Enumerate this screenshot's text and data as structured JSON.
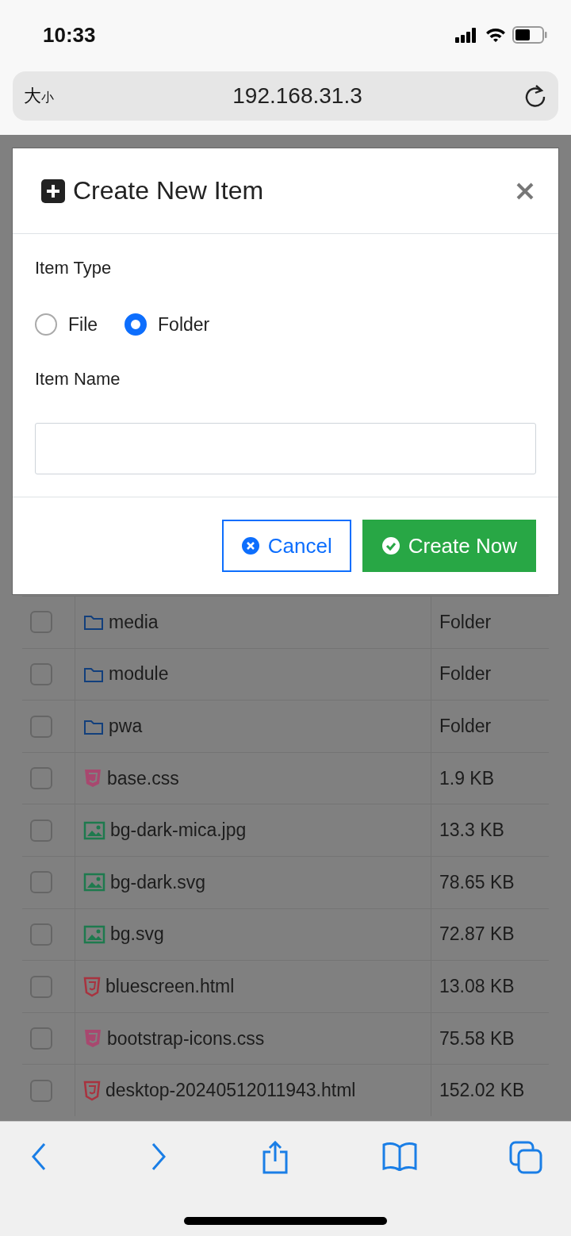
{
  "status_bar": {
    "time": "10:33"
  },
  "address_bar": {
    "text_size": {
      "large": "大",
      "small": "小"
    },
    "url": "192.168.31.3"
  },
  "file_table": {
    "rows": [
      {
        "kind": "folder",
        "name": "media",
        "size": "Folder",
        "checked": false
      },
      {
        "kind": "folder",
        "name": "module",
        "size": "Folder",
        "checked": false
      },
      {
        "kind": "folder",
        "name": "pwa",
        "size": "Folder",
        "checked": false
      },
      {
        "kind": "css",
        "name": "base.css",
        "size": "1.9 KB",
        "checked": false
      },
      {
        "kind": "image",
        "name": "bg-dark-mica.jpg",
        "size": "13.3 KB",
        "checked": false
      },
      {
        "kind": "image",
        "name": "bg-dark.svg",
        "size": "78.65 KB",
        "checked": false
      },
      {
        "kind": "image",
        "name": "bg.svg",
        "size": "72.87 KB",
        "checked": false
      },
      {
        "kind": "html",
        "name": "bluescreen.html",
        "size": "13.08 KB",
        "checked": false
      },
      {
        "kind": "css",
        "name": "bootstrap-icons.css",
        "size": "75.58 KB",
        "checked": false
      },
      {
        "kind": "html",
        "name": "desktop-20240512011943.html",
        "size": "152.02 KB",
        "checked": false
      }
    ]
  },
  "dialog": {
    "title": "Create New Item",
    "item_type_label": "Item Type",
    "item_types": [
      {
        "label": "File",
        "selected": false
      },
      {
        "label": "Folder",
        "selected": true
      }
    ],
    "item_name_label": "Item Name",
    "buttons": [
      {
        "kind": "outline",
        "label": "Cancel"
      },
      {
        "kind": "primary",
        "label": "Create Now"
      }
    ]
  }
}
